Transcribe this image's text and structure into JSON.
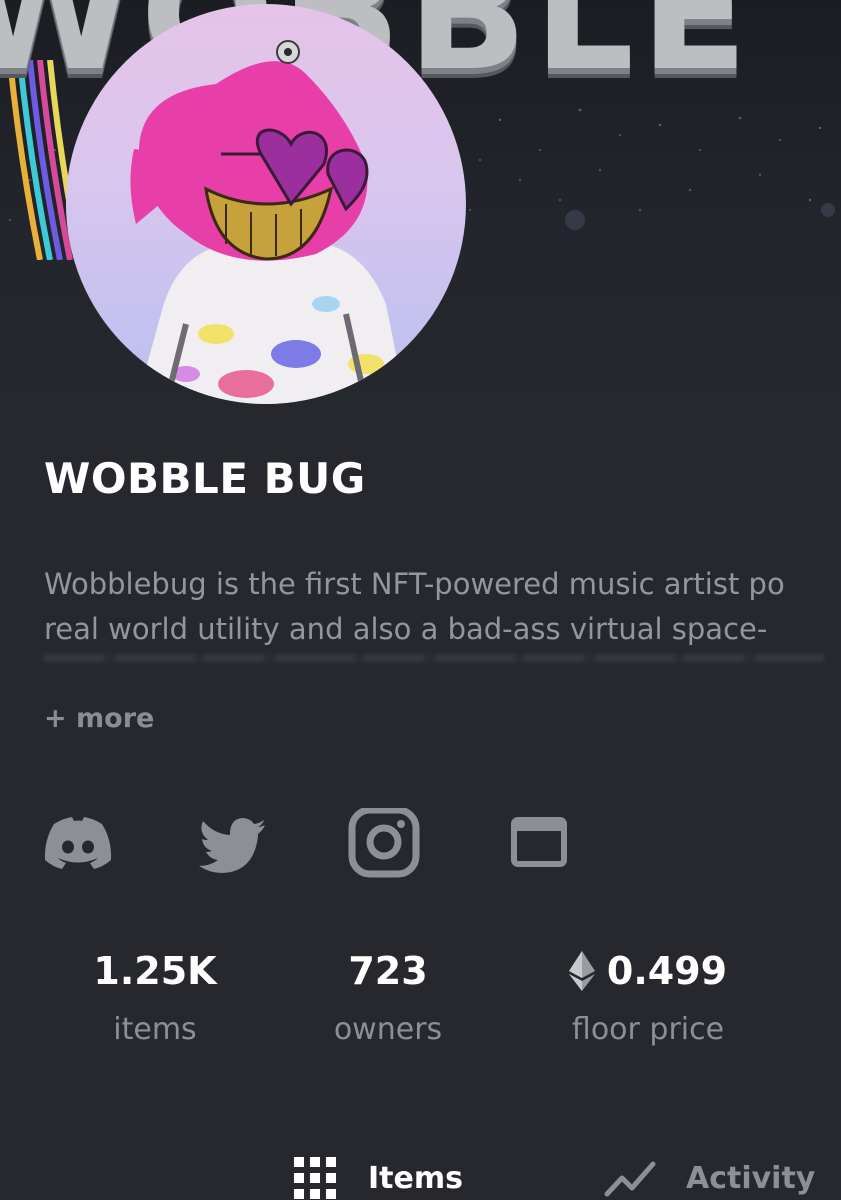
{
  "banner": {
    "text": "WOBBLE"
  },
  "collection": {
    "name": "WOBBLE BUG",
    "description_lines": [
      "Wobblebug is the first NFT-powered music artist po",
      "real world utility and also a bad-ass virtual space-"
    ],
    "more_label": "+ more"
  },
  "social": {
    "discord_icon": "discord-icon",
    "twitter_icon": "twitter-icon",
    "instagram_icon": "instagram-icon",
    "website_icon": "website-icon"
  },
  "stats": {
    "items": {
      "value": "1.25K",
      "label": "items"
    },
    "owners": {
      "value": "723",
      "label": "owners"
    },
    "floor": {
      "value": "0.499",
      "label": "floor price",
      "icon": "ethereum-icon"
    }
  },
  "tabs": {
    "items_label": "Items",
    "items_icon": "grid-icon",
    "activity_label": "Activity",
    "activity_icon": "activity-chart-icon"
  },
  "colors": {
    "background": "#26282d",
    "text_primary": "#ffffff",
    "text_muted": "#8c8f95",
    "accent_pink": "#e83ea8"
  }
}
